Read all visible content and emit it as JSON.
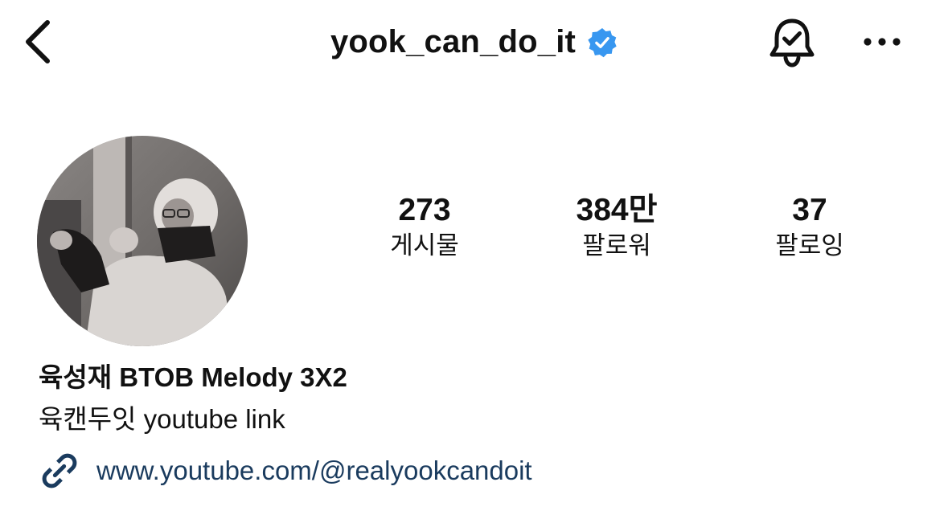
{
  "header": {
    "username": "yook_can_do_it",
    "verified": true,
    "icons": [
      "chevron-left-icon",
      "verified-badge-icon",
      "notification-bell-icon",
      "more-dots-icon"
    ]
  },
  "profile": {
    "avatar": "profile-photo",
    "stats": [
      {
        "value": "273",
        "label": "게시물"
      },
      {
        "value": "384만",
        "label": "팔로워"
      },
      {
        "value": "37",
        "label": "팔로잉"
      }
    ],
    "display_name": "육성재 BTOB Melody 3X2",
    "bio": "육캔두잇 youtube link",
    "link": "www.youtube.com/@realyookcandoit"
  },
  "colors": {
    "verified_blue": "#3897f0",
    "link_blue": "#1a3b5e",
    "text": "#111111",
    "background": "#ffffff"
  }
}
